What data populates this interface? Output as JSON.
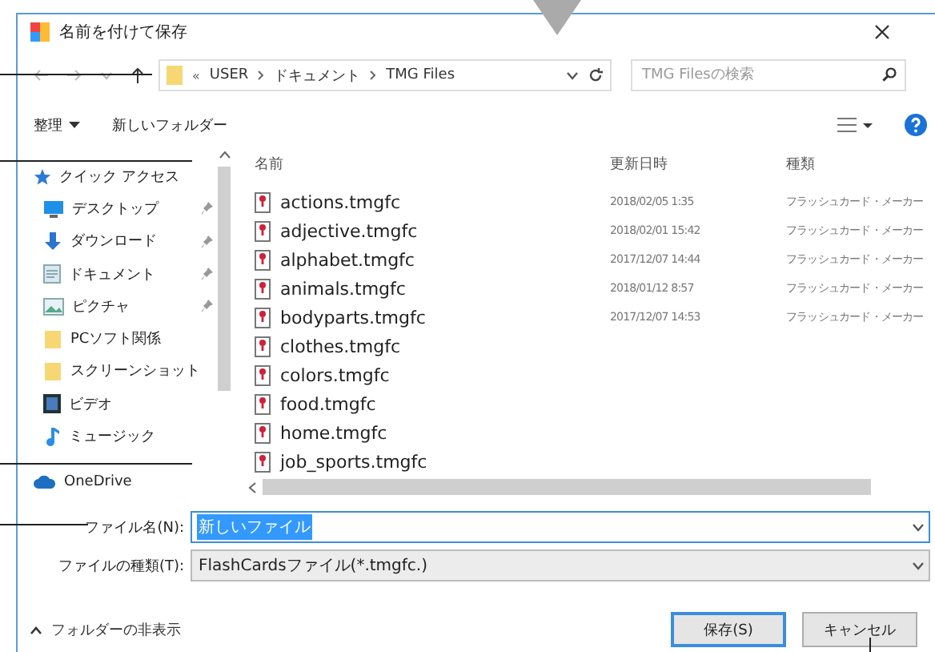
{
  "window": {
    "title": "名前を付けて保存"
  },
  "nav": {
    "crumb_prefix": "«",
    "breadcrumb": [
      "USER",
      "ドキュメント",
      "TMG Files"
    ],
    "search": {
      "placeholder": "TMG Filesの検索"
    }
  },
  "toolbar": {
    "organize": "整理",
    "new_folder": "新しいフォルダー"
  },
  "sidebar": {
    "items": [
      {
        "label": "クイック アクセス",
        "kind": "star",
        "pinned": false
      },
      {
        "label": "デスクトップ",
        "kind": "desktop",
        "pinned": true
      },
      {
        "label": "ダウンロード",
        "kind": "download",
        "pinned": true
      },
      {
        "label": "ドキュメント",
        "kind": "document",
        "pinned": true
      },
      {
        "label": "ピクチャ",
        "kind": "picture",
        "pinned": true
      },
      {
        "label": "PCソフト関係",
        "kind": "folder",
        "pinned": false
      },
      {
        "label": "スクリーンショット",
        "kind": "folder",
        "pinned": false
      },
      {
        "label": "ビデオ",
        "kind": "video",
        "pinned": false
      },
      {
        "label": "ミュージック",
        "kind": "music",
        "pinned": false
      },
      {
        "label": "OneDrive",
        "kind": "cloud",
        "pinned": false
      }
    ]
  },
  "table": {
    "columns": [
      "名前",
      "更新日時",
      "種類"
    ],
    "rows": [
      {
        "name": "actions.tmgfc",
        "date": "2018/02/05 1:35",
        "type": "フラッシュカード・メーカー"
      },
      {
        "name": "adjective.tmgfc",
        "date": "2018/02/01 15:42",
        "type": "フラッシュカード・メーカー"
      },
      {
        "name": "alphabet.tmgfc",
        "date": "2017/12/07 14:44",
        "type": "フラッシュカード・メーカー"
      },
      {
        "name": "animals.tmgfc",
        "date": "2018/01/12 8:57",
        "type": "フラッシュカード・メーカー"
      },
      {
        "name": "bodyparts.tmgfc",
        "date": "2017/12/07 14:53",
        "type": "フラッシュカード・メーカー"
      },
      {
        "name": "clothes.tmgfc"
      },
      {
        "name": "colors.tmgfc"
      },
      {
        "name": "food.tmgfc"
      },
      {
        "name": "home.tmgfc"
      },
      {
        "name": "job_sports.tmgfc"
      }
    ]
  },
  "file_name": {
    "label": "ファイル名(N):",
    "value": "新しいファイル",
    "selected": true
  },
  "file_type": {
    "label": "ファイルの種類(T):",
    "value": "FlashCardsファイル(*.tmgfc.)"
  },
  "hide_folders": "フォルダーの非表示",
  "buttons": [
    {
      "label": "保存(S)",
      "default": true
    },
    {
      "label": "キャンセル",
      "default": false
    }
  ]
}
